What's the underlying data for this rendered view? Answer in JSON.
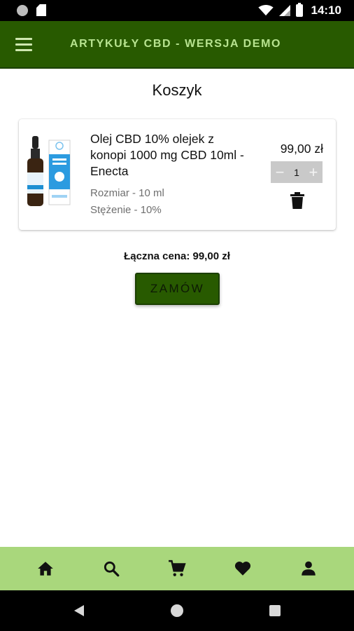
{
  "status_bar": {
    "time": "14:10",
    "icons": [
      "circle-notification-icon",
      "sd-card-icon",
      "wifi-icon",
      "signal-icon",
      "battery-icon"
    ]
  },
  "app_bar": {
    "title": "ARTYKUŁY CBD - WERSJA DEMO",
    "menu_icon": "hamburger-menu-icon"
  },
  "page": {
    "title": "Koszyk"
  },
  "cart": {
    "items": [
      {
        "name": "Olej CBD 10% olejek z konopi 1000 mg CBD 10ml - Enecta",
        "size": "Rozmiar - 10 ml",
        "concentration": "Stężenie - 10%",
        "price": "99,00 zł",
        "quantity": "1",
        "minus": "−",
        "plus": "+"
      }
    ],
    "total": "Łączna cena: 99,00 zł",
    "order_label": "ZAMÓW"
  },
  "bottom_nav": {
    "items": [
      "home-icon",
      "search-icon",
      "cart-icon",
      "heart-icon",
      "person-icon"
    ]
  },
  "colors": {
    "primary": "#285a00",
    "app_title": "#b7e38f",
    "bottom_nav": "#a9d77c"
  }
}
